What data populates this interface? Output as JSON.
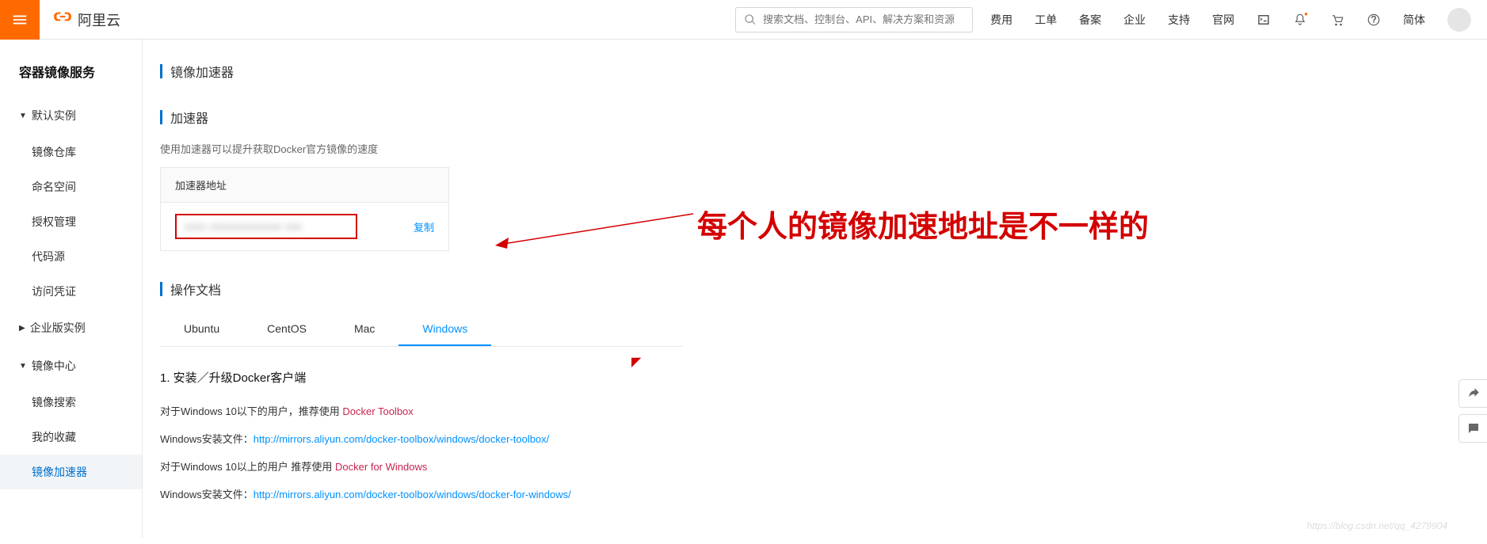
{
  "header": {
    "brand": "阿里云",
    "search_placeholder": "搜索文档、控制台、API、解决方案和资源",
    "nav": [
      "费用",
      "工单",
      "备案",
      "企业",
      "支持",
      "官网"
    ],
    "lang": "简体"
  },
  "sidebar": {
    "title": "容器镜像服务",
    "groups": [
      {
        "label": "默认实例",
        "items": [
          "镜像仓库",
          "命名空间",
          "授权管理",
          "代码源",
          "访问凭证"
        ]
      },
      {
        "label": "企业版实例",
        "items": []
      },
      {
        "label": "镜像中心",
        "items": [
          "镜像搜索",
          "我的收藏",
          "镜像加速器"
        ]
      }
    ],
    "active": "镜像加速器"
  },
  "page": {
    "title": "镜像加速器",
    "section1_title": "加速器",
    "section1_desc": "使用加速器可以提升获取Docker官方镜像的速度",
    "accel_head": "加速器地址",
    "accel_addr_blur": "xxxx xxxxxxxxxxxxx xxx",
    "copy": "复制",
    "section2_title": "操作文档",
    "tabs": [
      "Ubuntu",
      "CentOS",
      "Mac",
      "Windows"
    ],
    "active_tab": "Windows",
    "doc_h": "1. 安装／升级Docker客户端",
    "doc_p1_a": "对于Windows 10以下的用户，推荐使用 ",
    "doc_p1_b": "Docker Toolbox",
    "doc_p2_a": "Windows安装文件：",
    "doc_p2_b": "http://mirrors.aliyun.com/docker-toolbox/windows/docker-toolbox/",
    "doc_p3_a": "对于Windows 10以上的用户 推荐使用 ",
    "doc_p3_b": "Docker for Windows",
    "doc_p4_a": "Windows安装文件：",
    "doc_p4_b": "http://mirrors.aliyun.com/docker-toolbox/windows/docker-for-windows/"
  },
  "annotation": "每个人的镜像加速地址是不一样的",
  "watermark": "https://blog.csdn.net/qq_4279904"
}
